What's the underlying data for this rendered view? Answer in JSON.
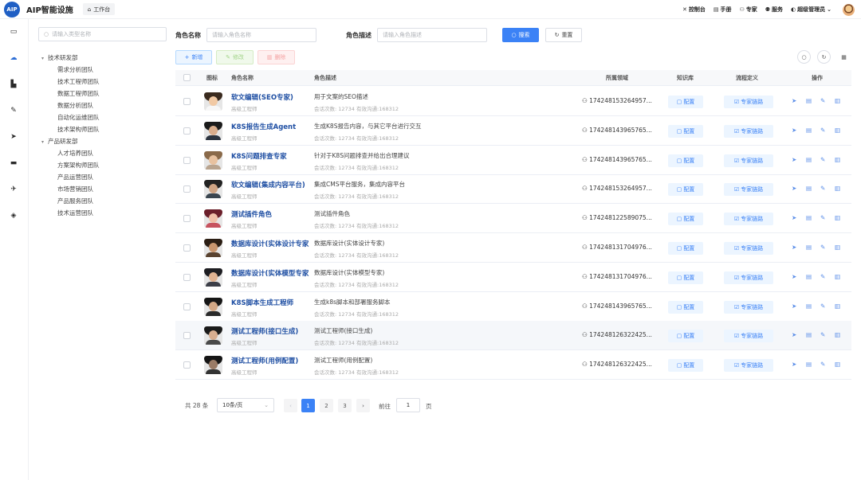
{
  "app": {
    "logo": "AIP",
    "title": "AIP智能设施",
    "workspace_tab": "工作台"
  },
  "topnav": {
    "items": [
      {
        "icon": "dashboard-icon",
        "glyph": "✕",
        "label": "控制台"
      },
      {
        "icon": "manual-icon",
        "glyph": "▤",
        "label": "手册"
      },
      {
        "icon": "expert-icon",
        "glyph": "⚇",
        "label": "专家"
      },
      {
        "icon": "service-icon",
        "glyph": "⚉",
        "label": "服务"
      },
      {
        "icon": "admin-icon",
        "glyph": "◐",
        "label": "超级管理员"
      }
    ],
    "chevron": "⌄"
  },
  "rail_icons": [
    "monitor-icon",
    "cloud-icon",
    "building-icon",
    "pin-icon",
    "send-icon",
    "briefcase-icon",
    "rocket-icon",
    "flame-icon"
  ],
  "tree": {
    "search_placeholder": "请输入类型名称",
    "groups": [
      {
        "label": "技术研发部",
        "children": [
          "需求分析团队",
          "技术工程师团队",
          "数据工程师团队",
          "数据分析团队",
          "自动化运维团队",
          "技术架构师团队"
        ]
      },
      {
        "label": "产品研发部",
        "children": [
          "人才培养团队",
          "方案架构师团队",
          "产品运营团队",
          "市场营销团队",
          "产品服务团队",
          "技术运营团队"
        ]
      }
    ]
  },
  "filters": {
    "role_name_label": "角色名称",
    "role_name_placeholder": "请输入角色名称",
    "role_desc_label": "角色描述",
    "role_desc_placeholder": "请输入角色描述",
    "search_label": "搜索",
    "reset_label": "重置"
  },
  "toolbar": {
    "add_label": "新增",
    "edit_label": "修改",
    "delete_label": "删除"
  },
  "table": {
    "headers": {
      "icon": "图标",
      "name": "角色名称",
      "desc": "角色描述",
      "domain": "所属领域",
      "kb": "知识库",
      "flow": "流程定义",
      "ops": "操作"
    },
    "kb_button": "配置",
    "flow_button": "专家链路",
    "rows": [
      {
        "name": "软文编辑(SEO专家)",
        "title": "高级工程师",
        "desc": "用于文案的SEO描述",
        "stats": "会话次数: 12734 有效沟通:168312",
        "domain": "174248153264957...",
        "colors": [
          "#3a2a1e",
          "#f1c9a4",
          "#f7f7f7"
        ]
      },
      {
        "name": "K8S报告生成Agent",
        "title": "高级工程师",
        "desc": "生成K8S报告内容，与其它平台进行交互",
        "stats": "会话次数: 12734 有效沟通:168312",
        "domain": "174248143965765...",
        "colors": [
          "#1b1b1b",
          "#d9ad8c",
          "#2d3540"
        ]
      },
      {
        "name": "K8S问题排查专家",
        "title": "高级工程师",
        "desc": "针对于K8S问题排查并给出合理建议",
        "stats": "会话次数: 12734 有效沟通:168312",
        "domain": "174248143965765...",
        "colors": [
          "#8a6a4a",
          "#e8c2a0",
          "#b9a48f"
        ]
      },
      {
        "name": "软文编辑(集成内容平台)",
        "title": "高级工程师",
        "desc": "集成CMS平台服务，集成内容平台",
        "stats": "会话次数: 12734 有效沟通:168312",
        "domain": "174248153264957...",
        "colors": [
          "#222222",
          "#cfa484",
          "#3b4650"
        ]
      },
      {
        "name": "测试插件角色",
        "title": "高级工程师",
        "desc": "测试插件角色",
        "stats": "会话次数: 12734 有效沟通:168312",
        "domain": "174248122589075...",
        "colors": [
          "#6b1f2a",
          "#f0c0a8",
          "#c7535f"
        ]
      },
      {
        "name": "数据库设计(实体设计专家)",
        "title": "高级工程师",
        "desc": "数据库设计(实体设计专家)",
        "stats": "会话次数: 12734 有效沟通:168312",
        "domain": "174248131704976...",
        "colors": [
          "#2b1e14",
          "#c9966e",
          "#5a4330"
        ]
      },
      {
        "name": "数据库设计(实体模型专家)",
        "title": "高级工程师",
        "desc": "数据库设计(实体模型专家)",
        "stats": "会话次数: 12734 有效沟通:168312",
        "domain": "174248131704976...",
        "colors": [
          "#1e1e22",
          "#e0b392",
          "#3c3f48"
        ]
      },
      {
        "name": "K8S脚本生成工程师",
        "title": "高级工程师",
        "desc": "生成k8s脚本和部署服务脚本",
        "stats": "会话次数: 12734 有效沟通:168312",
        "domain": "174248143965765...",
        "colors": [
          "#161616",
          "#d3a886",
          "#2a2a2a"
        ]
      },
      {
        "name": "测试工程师(接口生成)",
        "title": "高级工程师",
        "desc": "测试工程师(接口生成)",
        "stats": "会话次数: 12734 有效沟通:168312",
        "domain": "174248126322425...",
        "colors": [
          "#1a1a1a",
          "#d8ae90",
          "#4a4a4a"
        ]
      },
      {
        "name": "测试工程师(用例配置)",
        "title": "高级工程师",
        "desc": "测试工程师(用例配置)",
        "stats": "会话次数: 12734 有效沟通:168312",
        "domain": "174248126322425...",
        "colors": [
          "#151515",
          "#9a7b66",
          "#333333"
        ]
      }
    ]
  },
  "pagination": {
    "total": "共 28 条",
    "page_size": "10条/页",
    "pages": [
      "1",
      "2",
      "3"
    ],
    "active_page": "1",
    "goto_label": "前往",
    "goto_value": "1",
    "page_unit": "页"
  },
  "colors": {
    "primary": "#3b82f6",
    "brand": "#1f5fc4",
    "link": "#1f4fa3"
  }
}
